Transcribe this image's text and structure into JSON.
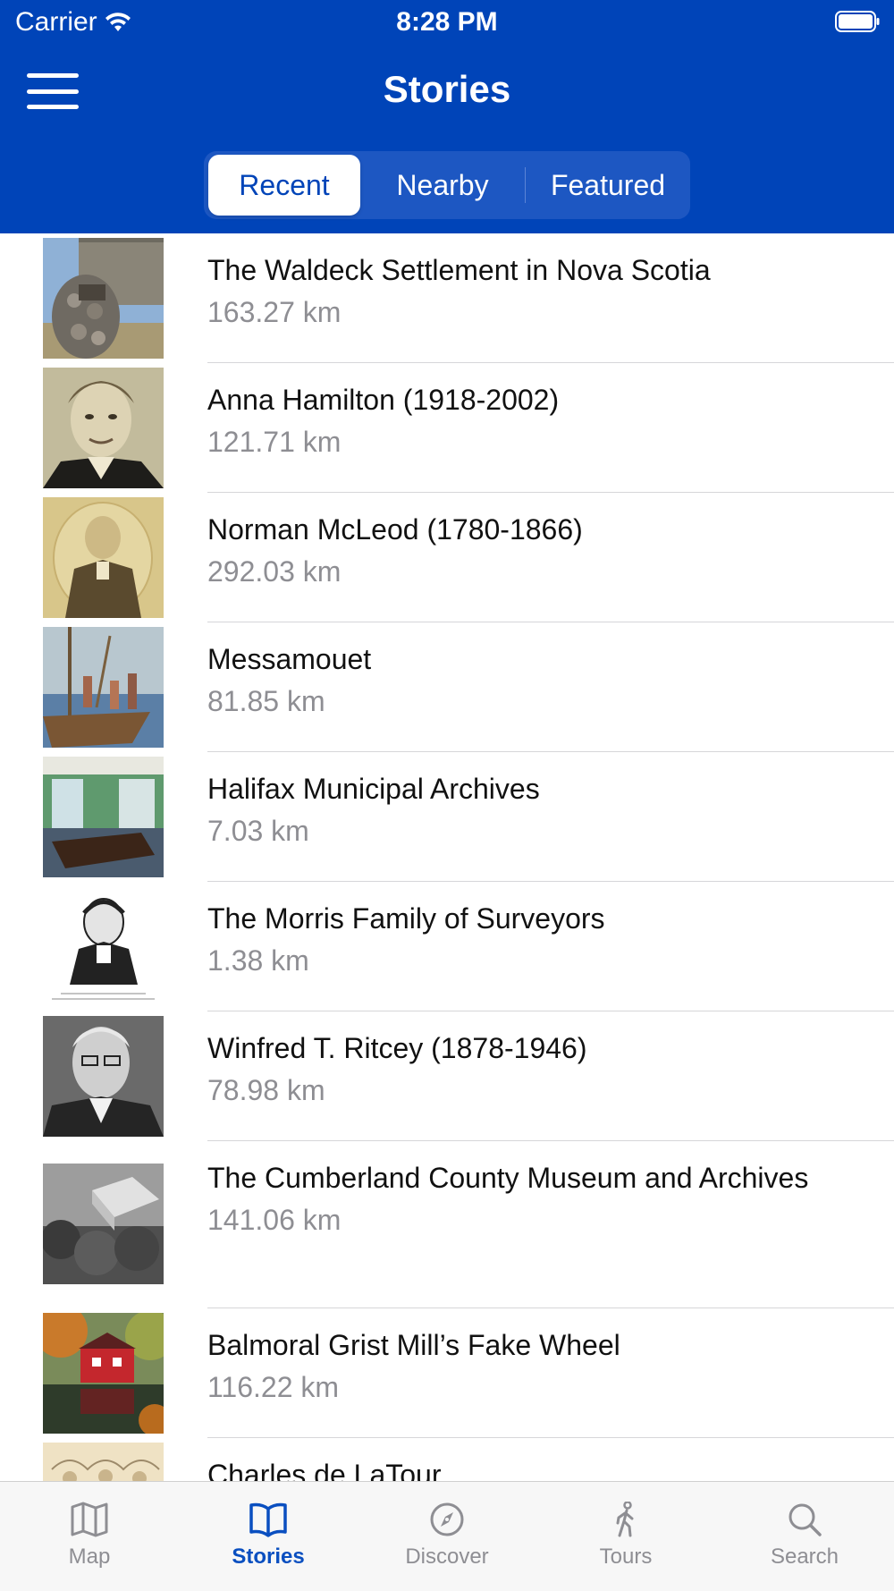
{
  "status_bar": {
    "carrier": "Carrier",
    "time": "8:28 PM"
  },
  "nav": {
    "title": "Stories",
    "menu_icon": "hamburger-menu-icon"
  },
  "segments": [
    {
      "label": "Recent",
      "selected": true
    },
    {
      "label": "Nearby",
      "selected": false
    },
    {
      "label": "Featured",
      "selected": false
    }
  ],
  "stories": [
    {
      "title": "The Waldeck Settlement in Nova Scotia",
      "distance": "163.27 km"
    },
    {
      "title": "Anna Hamilton (1918-2002)",
      "distance": "121.71 km"
    },
    {
      "title": "Norman McLeod (1780-1866)",
      "distance": "292.03 km"
    },
    {
      "title": "Messamouet",
      "distance": "81.85 km"
    },
    {
      "title": "Halifax Municipal Archives",
      "distance": "7.03 km"
    },
    {
      "title": "The Morris Family of Surveyors",
      "distance": "1.38 km"
    },
    {
      "title": "Winfred T. Ritcey (1878-1946)",
      "distance": "78.98 km"
    },
    {
      "title": "The Cumberland County Museum and Archives",
      "distance": "141.06 km"
    },
    {
      "title": "Balmoral Grist Mill’s Fake Wheel",
      "distance": "116.22 km"
    },
    {
      "title": "Charles de LaTour",
      "distance": ""
    }
  ],
  "tabs": [
    {
      "label": "Map",
      "icon": "map-icon",
      "active": false
    },
    {
      "label": "Stories",
      "icon": "book-icon",
      "active": true
    },
    {
      "label": "Discover",
      "icon": "compass-icon",
      "active": false
    },
    {
      "label": "Tours",
      "icon": "walking-person-icon",
      "active": false
    },
    {
      "label": "Search",
      "icon": "search-icon",
      "active": false
    }
  ],
  "colors": {
    "header": "#0044b8",
    "accent": "#0a4fc0",
    "secondary_text": "#8e8e93"
  }
}
